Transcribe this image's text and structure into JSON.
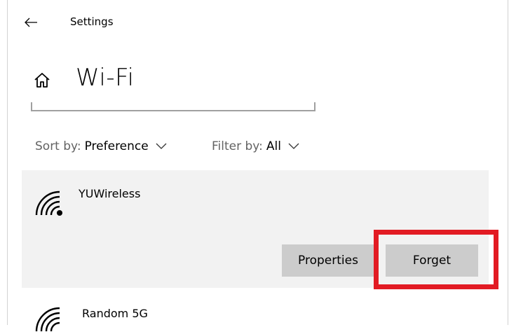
{
  "header": {
    "title": "Settings",
    "back_icon": "arrow-left-icon"
  },
  "page": {
    "title": "Wi-Fi",
    "home_icon": "home-icon"
  },
  "filters": {
    "sort_label": "Sort by:",
    "sort_value": "Preference",
    "filter_label": "Filter by:",
    "filter_value": "All"
  },
  "networks": [
    {
      "name": "YUWireless",
      "icon": "wifi-secured-icon",
      "expanded": true,
      "properties_label": "Properties",
      "forget_label": "Forget"
    },
    {
      "name": "Random 5G",
      "icon": "wifi-icon",
      "expanded": false
    }
  ],
  "colors": {
    "accent_highlight": "#e21b23",
    "selected_bg": "#f2f2f2",
    "button_bg": "#cccccc",
    "secondary_text": "#636363"
  }
}
